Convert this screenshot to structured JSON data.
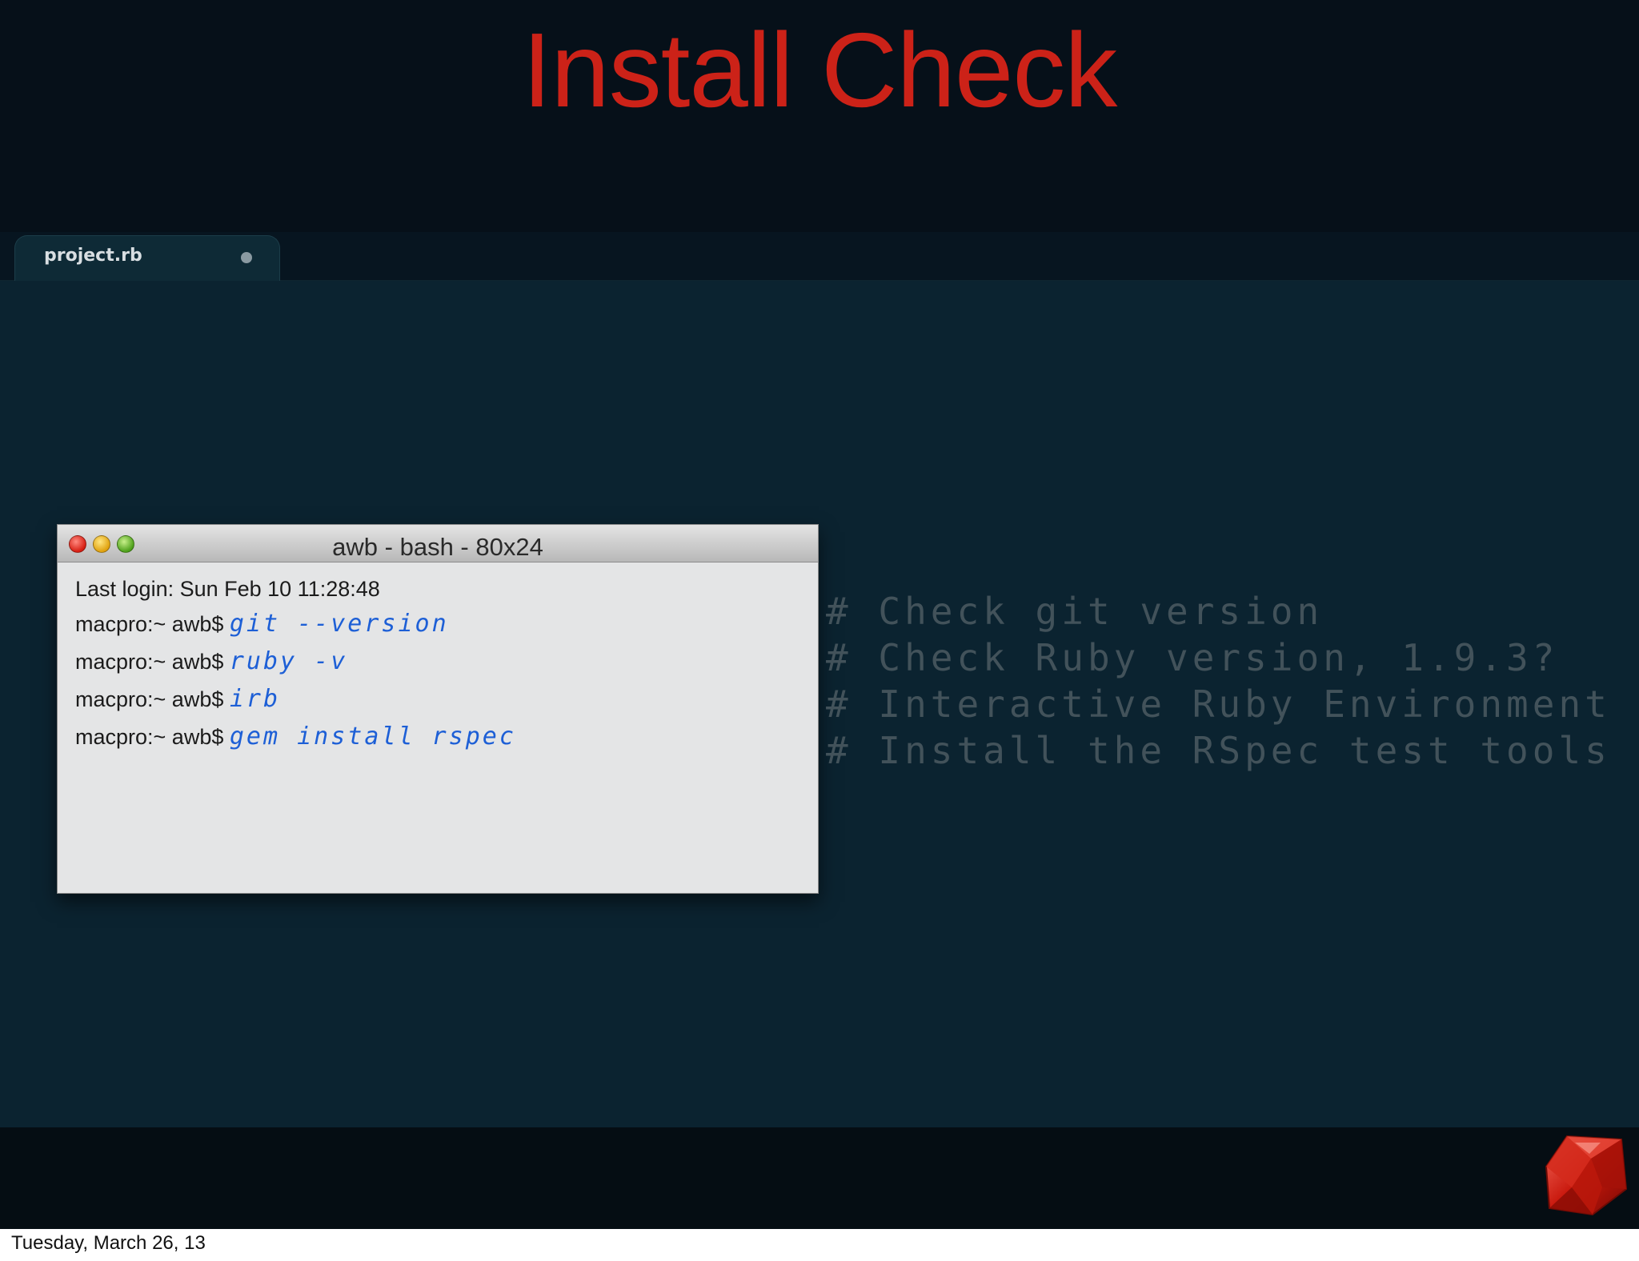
{
  "slide": {
    "title": "Install Check"
  },
  "editor": {
    "tab_label": "project.rb"
  },
  "terminal": {
    "window_title": "awb - bash - 80x24",
    "last_login": "Last login: Sun Feb 10 11:28:48",
    "lines": [
      {
        "prompt": "macpro:~ awb$ ",
        "command": "git --version"
      },
      {
        "prompt": "macpro:~ awb$ ",
        "command": "ruby -v"
      },
      {
        "prompt": "macpro:~ awb$ ",
        "command": "irb"
      },
      {
        "prompt": "macpro:~ awb$ ",
        "command": "gem install rspec"
      }
    ]
  },
  "comments": [
    "# Check git version",
    "# Check Ruby version, 1.9.3?",
    "# Interactive Ruby Environment",
    "# Install the RSpec test tools"
  ],
  "footer": {
    "date": "Tuesday, March 26, 13"
  },
  "colors": {
    "title": "#cc2218",
    "command": "#1d5fd6",
    "comment": "#42525a",
    "background": "#061019"
  },
  "icons": {
    "logo": "ruby-gem-icon"
  }
}
